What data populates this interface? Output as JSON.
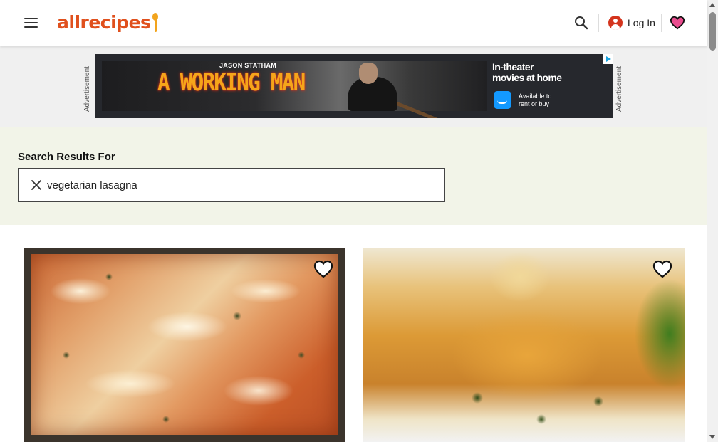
{
  "header": {
    "menu_icon": "hamburger-menu-icon",
    "logo_text": "allrecipes",
    "search_icon": "magnifier-search-icon",
    "login_label": "Log In",
    "login_icon": "user-avatar-icon",
    "favorites_icon": "heart-icon",
    "brand_color": "#e0501d",
    "favorites_color": "#ea4d8f"
  },
  "ad": {
    "side_label_left": "Advertisement",
    "side_label_right": "Advertisement",
    "actor": "JASON STATHAM",
    "movie_title": "A WORKING MAN",
    "tagline_line1": "In-theater",
    "tagline_line2": "movies at home",
    "prime_line1": "Available to",
    "prime_line2": "rent or buy",
    "adchoices_icon": "adchoices-icon"
  },
  "search": {
    "heading": "Search Results For",
    "query": "vegetarian lasagna",
    "clear_icon": "close-x-icon",
    "band_color": "#f2f4e8"
  },
  "results": [
    {
      "image": "baked vegetarian lasagna in pan",
      "save_icon": "heart-outline-icon"
    },
    {
      "image": "slice of spinach lasagna on plate",
      "save_icon": "heart-outline-icon"
    }
  ]
}
